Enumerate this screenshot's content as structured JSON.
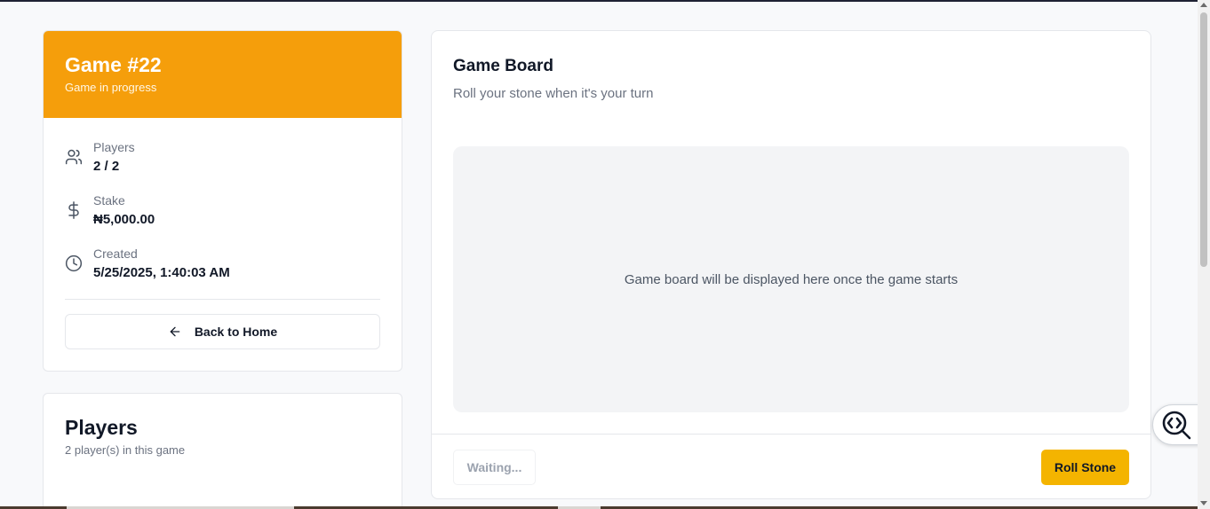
{
  "game": {
    "title": "Game #22",
    "status": "Game in progress",
    "players_label": "Players",
    "players_value": "2 / 2",
    "stake_label": "Stake",
    "stake_value": "₦5,000.00",
    "created_label": "Created",
    "created_value": "5/25/2025, 1:40:03 AM",
    "back_label": "Back to Home",
    "header_color": "#f59e0b"
  },
  "players": {
    "title": "Players",
    "subtitle": "2 player(s) in this game"
  },
  "board": {
    "title": "Game Board",
    "subtitle": "Roll your stone when it's your turn",
    "placeholder": "Game board will be displayed here once the game starts",
    "waiting_label": "Waiting...",
    "roll_label": "Roll Stone",
    "roll_color": "#f4b400"
  },
  "icons": {
    "players": "users-icon",
    "stake": "dollar-icon",
    "created": "clock-icon",
    "back": "arrow-left-icon",
    "widget": "code-search-icon"
  }
}
